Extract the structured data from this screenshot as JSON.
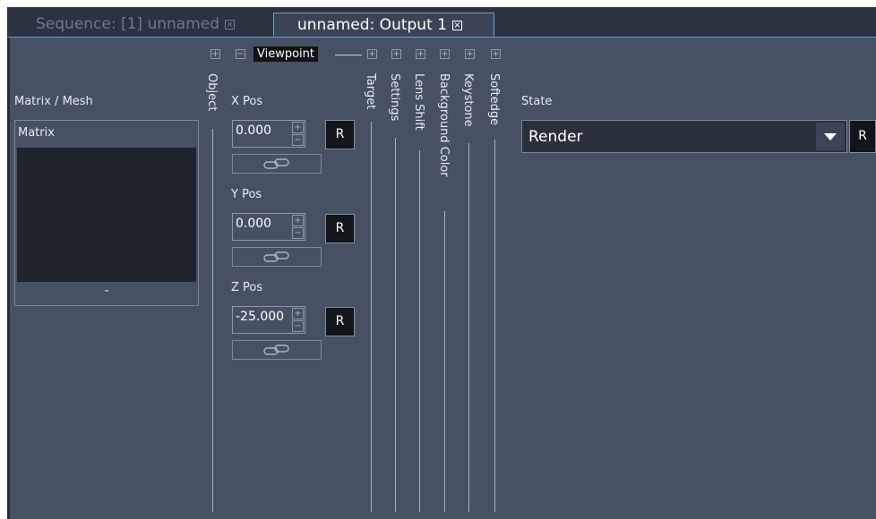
{
  "tabs": [
    {
      "label": "Sequence: [1] unnamed",
      "active": false
    },
    {
      "label": "unnamed: Output 1",
      "active": true
    }
  ],
  "icons": {
    "close": "close-x-icon",
    "expand": "plus-box-icon",
    "collapse": "minus-box-icon",
    "link": "chain-link-icon",
    "dropdown": "triangle-down-icon"
  },
  "section_headers": {
    "viewpoint": "Viewpoint",
    "vertical": [
      "Object",
      "Target",
      "Settings",
      "Lens Shift",
      "Background Color",
      "Keystone",
      "Softedge"
    ]
  },
  "matrix_mesh": {
    "label": "Matrix / Mesh",
    "list_header": "Matrix",
    "footer": "-"
  },
  "positions": [
    {
      "label": "X Pos",
      "value": "0.000",
      "reset": "R"
    },
    {
      "label": "Y Pos",
      "value": "0.000",
      "reset": "R"
    },
    {
      "label": "Z Pos",
      "value": "-25.000",
      "reset": "R"
    }
  ],
  "state": {
    "label": "State",
    "value": "Render",
    "reset": "R"
  },
  "colors": {
    "panel": "#465164",
    "tabbar": "#2b3240",
    "accent": "#6e9cd6",
    "field_dark": "#1f242d"
  }
}
